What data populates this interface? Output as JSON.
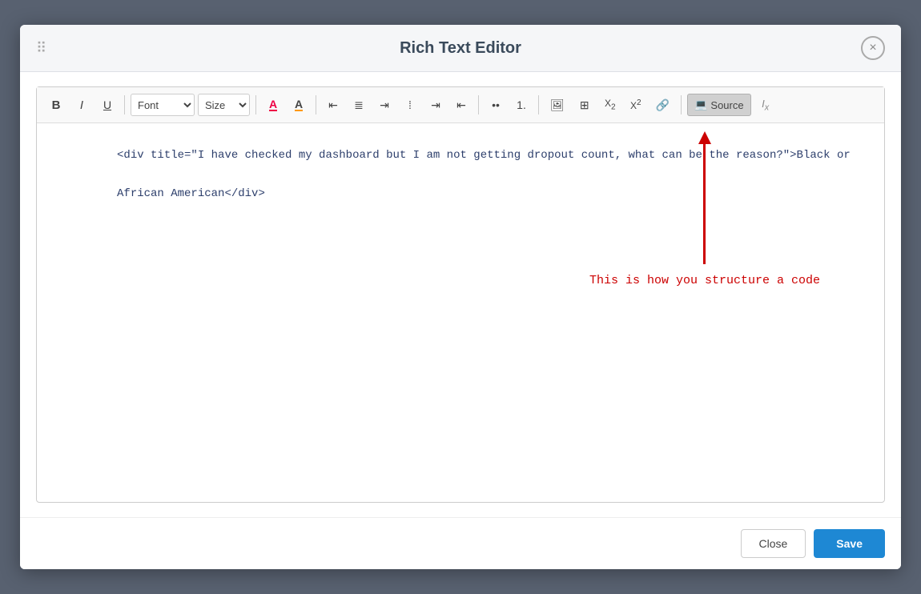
{
  "modal": {
    "title": "Rich Text Editor",
    "close_label": "×"
  },
  "toolbar": {
    "bold_label": "B",
    "italic_label": "I",
    "underline_label": "U",
    "font_label": "Font",
    "size_label": "Size",
    "source_label": "Source"
  },
  "editor": {
    "content_line1": "<div title=\"I have checked my dashboard but I am not getting dropout count, what can be the reason?\">Black or",
    "content_line2": "African American</div>"
  },
  "annotation": {
    "text": "This is how you structure a code"
  },
  "footer": {
    "close_label": "Close",
    "save_label": "Save"
  }
}
